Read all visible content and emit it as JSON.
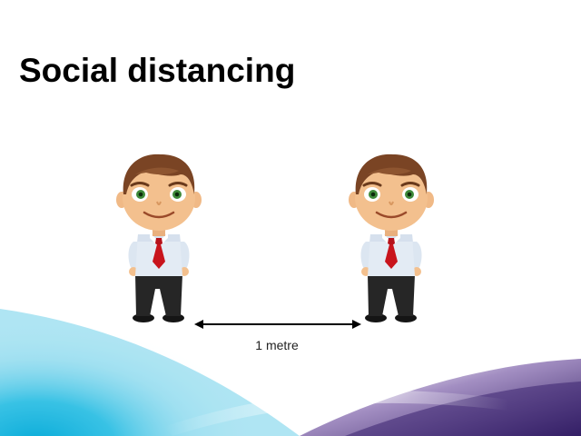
{
  "slide": {
    "title": "Social distancing",
    "distance_label": "1 metre"
  },
  "figures": [
    {
      "name": "person-left",
      "description_icon": "businessman-cartoon-icon"
    },
    {
      "name": "person-right",
      "description_icon": "businessman-cartoon-icon"
    }
  ],
  "colors": {
    "title": "#000000",
    "hair": "#7a4424",
    "skin": "#f3c08e",
    "shirt": "#dfe8f2",
    "tie": "#c8141c",
    "trousers": "#222222",
    "eyes": "#3f8a3a",
    "cyan_wave": "#1ab8e0",
    "purple_wave": "#4a2a7a"
  }
}
